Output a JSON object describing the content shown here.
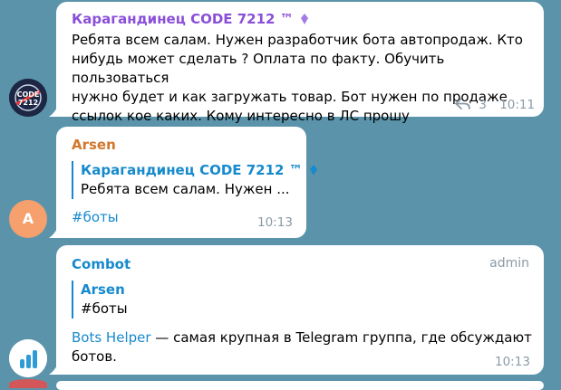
{
  "messages": [
    {
      "author": "Карагандинец CODE 7212 ™",
      "text": "Ребята всем салам. Нужен разработчик бота автопродаж. Кто нибудь может сделать ? Оплата по факту. Обучить пользоваться нужно будет и как загружать товар. Бот нужен по продаже ссылок кое каких. Кому интересно в ЛС прошу",
      "text_lines": [
        "Ребята всем салам. Нужен разработчик бота автопродаж. Кто",
        "нибудь может сделать ? Оплата по факту. Обучить пользоваться",
        "нужно будет и как загружать товар. Бот нужен по продаже",
        "ссылок кое каких. Кому интересно в ЛС прошу"
      ],
      "reply_count": "3",
      "time": "10:11"
    },
    {
      "author": "Arsen",
      "avatar_letter": "A",
      "reply_to": {
        "name": "Карагандинец CODE 7212 ™",
        "text": "Ребята всем салам. Нужен ..."
      },
      "text": "#боты",
      "time": "10:13"
    },
    {
      "author": "Combot",
      "badge": "admin",
      "reply_to": {
        "name": "Arsen",
        "text": "#боты"
      },
      "link_text": "Bots Helper",
      "text_line1_rest": " — самая крупная в Telegram группа, где обсуждают",
      "text_line2": "ботов.",
      "time": "10:13"
    }
  ],
  "colors": {
    "background": "#5b94aa",
    "author1": "#8a4fd8",
    "author2": "#d2762b",
    "author3": "#168acd",
    "link": "#168acd",
    "time": "#8a9aa6",
    "avatar_arsen": "#f5a06d"
  }
}
